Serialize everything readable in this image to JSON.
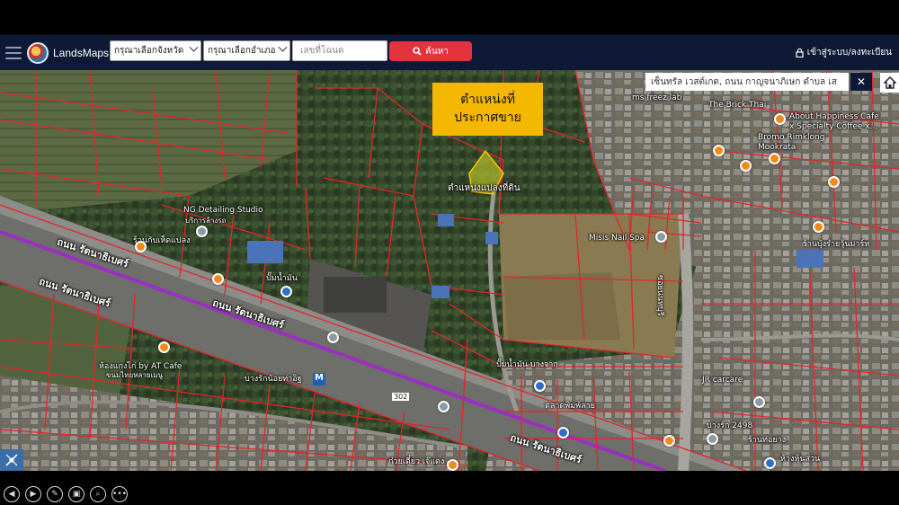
{
  "header": {
    "brand": "LandsMaps",
    "province_select": "กรุณาเลือกจังหวัด",
    "district_select": "กรุณาเลือกอำเภอ",
    "deed_placeholder": "เลขที่โฉนด",
    "search_label": "ค้นหา",
    "login_label": "เข้าสู่ระบบ/ลงทะเบียน"
  },
  "map": {
    "callout_line1": "ตำแหน่งที่",
    "callout_line2": "ประกาศขาย",
    "parcel_label": "ตำแหน่งแปลงที่ดิน",
    "search_text": "เซ็นทรัล เวสต์เกต, ถนน กาญจนาภิเษก ตำบล เส",
    "close_symbol": "✕",
    "route_shield": "302",
    "labels": {
      "ng_detailing": "NG Detailing Studio",
      "ng_detailing_sub": "บริการล้างรถ",
      "rama_left": "ร้านกับเห็ดแปลง",
      "rama_road_1": "ถนน รัตนาธิเบศร์",
      "rama_road_2": "ถนน รัตนาธิเบศร์",
      "rama_road_3": "ถนน รัตนาธิเบศร์",
      "rama_road_4": "ถนน รัตนาธิเบศร์",
      "gas_station": "ปั๊มน้ำมัน",
      "gas_station_2": "ปั๊มน้ำมัน บางจาก",
      "cafe": "ห้องแกงไก่ by AT Cafe",
      "cafe_sub": "ขนมไทยหลายเมนู",
      "station": "บางรักน้อยท่าอิฐ",
      "station_mark": "M",
      "misis": "Misis Nail Spa",
      "brick_1": "ms freez lab",
      "brick_2": "The Brick Thai",
      "happiness": "About Happiness Cafe",
      "happiness_sub": "x Specialty Coffee x...",
      "bromo": "Bromo Rimklong",
      "bromo_sub": "Mookrata",
      "jr_carcare": "JR carcare",
      "pharma": "ตลาดพิมพ์ลาย",
      "side_road": "ซอยนนทบุรี",
      "bottom_rama": "ถนน รัตนาธิเบศร์",
      "bottom_left": "ก๋วยเตี๋ยว เจ๊แดง",
      "bottom_right": "ห้างหุ้นส่วน",
      "right_shop": "ร้านบุ้งรำยวุ้นมาร์ท",
      "bldg_2498": "บางรัก 2498",
      "bldg_rubber": "ร้านท่อยาง"
    }
  },
  "colors": {
    "header_bg": "#0e1a35",
    "search_btn": "#e5323f",
    "callout": "#f5b800",
    "parcel_lines": "#e3262b",
    "rail": "#9b2fc2"
  },
  "icons": [
    "menu-icon",
    "search-icon",
    "lock-icon",
    "home-icon",
    "measure-tool-icon",
    "prev-icon",
    "next-icon",
    "draw-icon",
    "layers-icon",
    "zoom-icon",
    "more-icon"
  ]
}
